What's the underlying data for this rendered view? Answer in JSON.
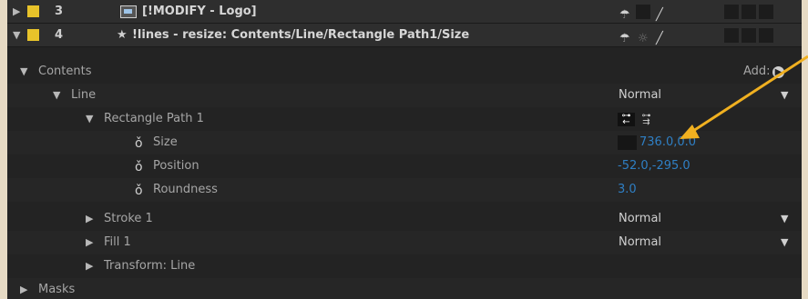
{
  "layers": [
    {
      "index": "3",
      "name": "[!MODIFY - Logo]",
      "label_color": "#e8c32a"
    },
    {
      "index": "4",
      "name": "!lines - resize: Contents/Line/Rectangle Path1/Size",
      "label_color": "#e8c32a"
    }
  ],
  "contents_label": "Contents",
  "add_label": "Add:",
  "line": {
    "label": "Line",
    "blend": "Normal"
  },
  "rect_path": {
    "label": "Rectangle Path 1"
  },
  "props": {
    "size": {
      "label": "Size",
      "value": "736.0,0.0"
    },
    "position": {
      "label": "Position",
      "value": "-52.0,-295.0"
    },
    "roundness": {
      "label": "Roundness",
      "value": "3.0"
    }
  },
  "stroke": {
    "label": "Stroke 1",
    "blend": "Normal"
  },
  "fill": {
    "label": "Fill 1",
    "blend": "Normal"
  },
  "transform": {
    "label": "Transform: Line"
  },
  "masks_label": "Masks",
  "colors": {
    "link_blue": "#2f7fc4",
    "annotation_arrow": "#f0b020",
    "panel_bg": "#232323",
    "page_bg": "#e6dac4"
  }
}
